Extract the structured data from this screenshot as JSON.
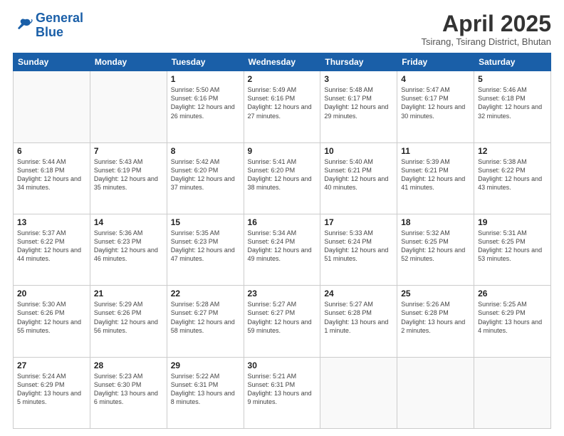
{
  "header": {
    "logo_line1": "General",
    "logo_line2": "Blue",
    "title": "April 2025",
    "subtitle": "Tsirang, Tsirang District, Bhutan"
  },
  "days_of_week": [
    "Sunday",
    "Monday",
    "Tuesday",
    "Wednesday",
    "Thursday",
    "Friday",
    "Saturday"
  ],
  "weeks": [
    [
      {
        "day": "",
        "info": ""
      },
      {
        "day": "",
        "info": ""
      },
      {
        "day": "1",
        "info": "Sunrise: 5:50 AM\nSunset: 6:16 PM\nDaylight: 12 hours and 26 minutes."
      },
      {
        "day": "2",
        "info": "Sunrise: 5:49 AM\nSunset: 6:16 PM\nDaylight: 12 hours and 27 minutes."
      },
      {
        "day": "3",
        "info": "Sunrise: 5:48 AM\nSunset: 6:17 PM\nDaylight: 12 hours and 29 minutes."
      },
      {
        "day": "4",
        "info": "Sunrise: 5:47 AM\nSunset: 6:17 PM\nDaylight: 12 hours and 30 minutes."
      },
      {
        "day": "5",
        "info": "Sunrise: 5:46 AM\nSunset: 6:18 PM\nDaylight: 12 hours and 32 minutes."
      }
    ],
    [
      {
        "day": "6",
        "info": "Sunrise: 5:44 AM\nSunset: 6:18 PM\nDaylight: 12 hours and 34 minutes."
      },
      {
        "day": "7",
        "info": "Sunrise: 5:43 AM\nSunset: 6:19 PM\nDaylight: 12 hours and 35 minutes."
      },
      {
        "day": "8",
        "info": "Sunrise: 5:42 AM\nSunset: 6:20 PM\nDaylight: 12 hours and 37 minutes."
      },
      {
        "day": "9",
        "info": "Sunrise: 5:41 AM\nSunset: 6:20 PM\nDaylight: 12 hours and 38 minutes."
      },
      {
        "day": "10",
        "info": "Sunrise: 5:40 AM\nSunset: 6:21 PM\nDaylight: 12 hours and 40 minutes."
      },
      {
        "day": "11",
        "info": "Sunrise: 5:39 AM\nSunset: 6:21 PM\nDaylight: 12 hours and 41 minutes."
      },
      {
        "day": "12",
        "info": "Sunrise: 5:38 AM\nSunset: 6:22 PM\nDaylight: 12 hours and 43 minutes."
      }
    ],
    [
      {
        "day": "13",
        "info": "Sunrise: 5:37 AM\nSunset: 6:22 PM\nDaylight: 12 hours and 44 minutes."
      },
      {
        "day": "14",
        "info": "Sunrise: 5:36 AM\nSunset: 6:23 PM\nDaylight: 12 hours and 46 minutes."
      },
      {
        "day": "15",
        "info": "Sunrise: 5:35 AM\nSunset: 6:23 PM\nDaylight: 12 hours and 47 minutes."
      },
      {
        "day": "16",
        "info": "Sunrise: 5:34 AM\nSunset: 6:24 PM\nDaylight: 12 hours and 49 minutes."
      },
      {
        "day": "17",
        "info": "Sunrise: 5:33 AM\nSunset: 6:24 PM\nDaylight: 12 hours and 51 minutes."
      },
      {
        "day": "18",
        "info": "Sunrise: 5:32 AM\nSunset: 6:25 PM\nDaylight: 12 hours and 52 minutes."
      },
      {
        "day": "19",
        "info": "Sunrise: 5:31 AM\nSunset: 6:25 PM\nDaylight: 12 hours and 53 minutes."
      }
    ],
    [
      {
        "day": "20",
        "info": "Sunrise: 5:30 AM\nSunset: 6:26 PM\nDaylight: 12 hours and 55 minutes."
      },
      {
        "day": "21",
        "info": "Sunrise: 5:29 AM\nSunset: 6:26 PM\nDaylight: 12 hours and 56 minutes."
      },
      {
        "day": "22",
        "info": "Sunrise: 5:28 AM\nSunset: 6:27 PM\nDaylight: 12 hours and 58 minutes."
      },
      {
        "day": "23",
        "info": "Sunrise: 5:27 AM\nSunset: 6:27 PM\nDaylight: 12 hours and 59 minutes."
      },
      {
        "day": "24",
        "info": "Sunrise: 5:27 AM\nSunset: 6:28 PM\nDaylight: 13 hours and 1 minute."
      },
      {
        "day": "25",
        "info": "Sunrise: 5:26 AM\nSunset: 6:28 PM\nDaylight: 13 hours and 2 minutes."
      },
      {
        "day": "26",
        "info": "Sunrise: 5:25 AM\nSunset: 6:29 PM\nDaylight: 13 hours and 4 minutes."
      }
    ],
    [
      {
        "day": "27",
        "info": "Sunrise: 5:24 AM\nSunset: 6:29 PM\nDaylight: 13 hours and 5 minutes."
      },
      {
        "day": "28",
        "info": "Sunrise: 5:23 AM\nSunset: 6:30 PM\nDaylight: 13 hours and 6 minutes."
      },
      {
        "day": "29",
        "info": "Sunrise: 5:22 AM\nSunset: 6:31 PM\nDaylight: 13 hours and 8 minutes."
      },
      {
        "day": "30",
        "info": "Sunrise: 5:21 AM\nSunset: 6:31 PM\nDaylight: 13 hours and 9 minutes."
      },
      {
        "day": "",
        "info": ""
      },
      {
        "day": "",
        "info": ""
      },
      {
        "day": "",
        "info": ""
      }
    ]
  ]
}
